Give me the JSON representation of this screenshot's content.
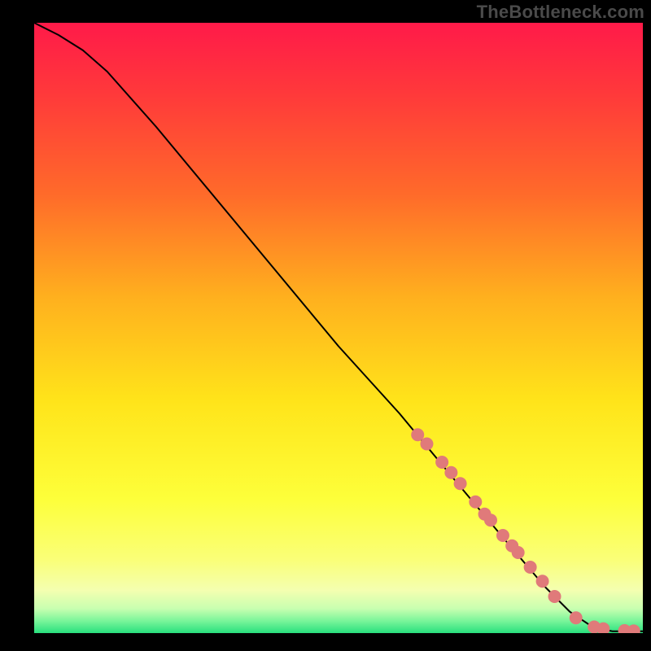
{
  "watermark": "TheBottleneck.com",
  "chart_data": {
    "type": "line",
    "title": "",
    "xlabel": "",
    "ylabel": "",
    "xlim": [
      0,
      100
    ],
    "ylim": [
      0,
      100
    ],
    "grid": false,
    "background_gradient": {
      "top_color": "#ff1a49",
      "mid_colors": [
        "#ff6a2a",
        "#ffb01e",
        "#ffe41a",
        "#fdff3a",
        "#f4ff9a",
        "#b9ffad"
      ],
      "bottom_color": "#28e07d"
    },
    "series": [
      {
        "name": "curve",
        "style": "line",
        "color": "#000000",
        "x": [
          0,
          4,
          8,
          12,
          20,
          30,
          40,
          50,
          60,
          70,
          78,
          84,
          88,
          91,
          93,
          95,
          100
        ],
        "y": [
          100,
          98,
          95.5,
          92,
          83,
          71,
          59,
          47,
          36,
          24,
          14.5,
          7.5,
          3.5,
          1.5,
          0.7,
          0.3,
          0.3
        ]
      },
      {
        "name": "highlight-points",
        "style": "scatter",
        "color": "#e07a7a",
        "radius": 8,
        "x": [
          63,
          64.5,
          67,
          68.5,
          70,
          72.5,
          74,
          75,
          77,
          78.5,
          79.5,
          81.5,
          83.5,
          85.5,
          89,
          92,
          93.5,
          97,
          98.5
        ],
        "y": [
          32.5,
          31,
          28,
          26.3,
          24.5,
          21.5,
          19.5,
          18.5,
          16,
          14.3,
          13.2,
          10.8,
          8.5,
          6,
          2.5,
          1,
          0.7,
          0.4,
          0.35
        ]
      }
    ]
  }
}
